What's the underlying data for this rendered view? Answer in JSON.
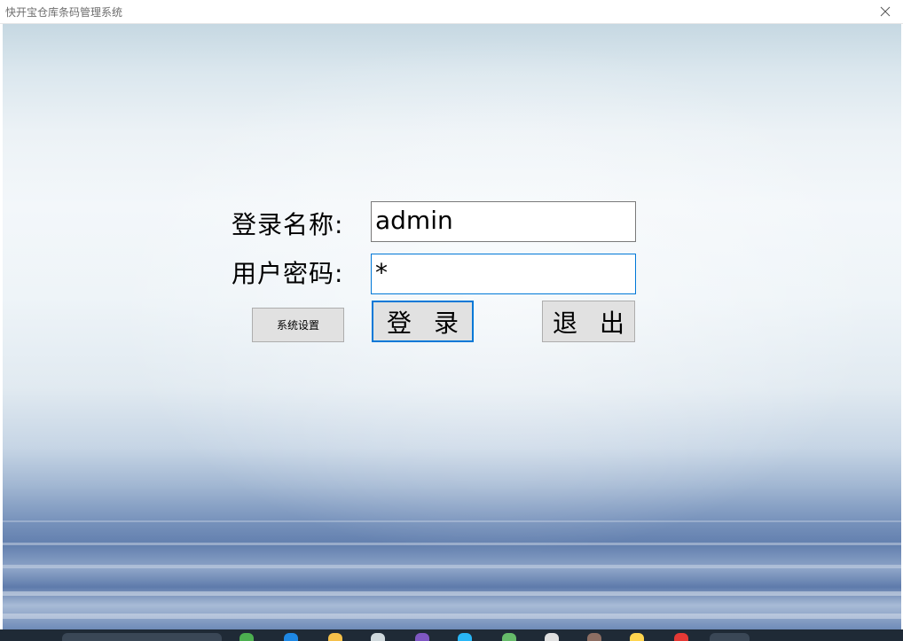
{
  "window": {
    "title": "快开宝仓库条码管理系统",
    "close_icon": "close-icon"
  },
  "login": {
    "username_label": "登录名称:",
    "username_value": "admin",
    "password_label": "用户密码:",
    "password_value": "*",
    "settings_button": "系统设置",
    "login_button": "登 录",
    "exit_button": "退 出"
  },
  "colors": {
    "focus_border": "#0078d7",
    "button_bg": "#e1e1e1",
    "taskbar_bg": "#1f2a36"
  },
  "taskbar": {
    "icons": [
      "taskbar-app-icon",
      "edge-icon",
      "folder-icon",
      "settings-icon",
      "app-icon",
      "mail-icon",
      "chrome-icon",
      "app-icon",
      "app-icon",
      "app-icon",
      "app-icon",
      "app-icon"
    ]
  }
}
